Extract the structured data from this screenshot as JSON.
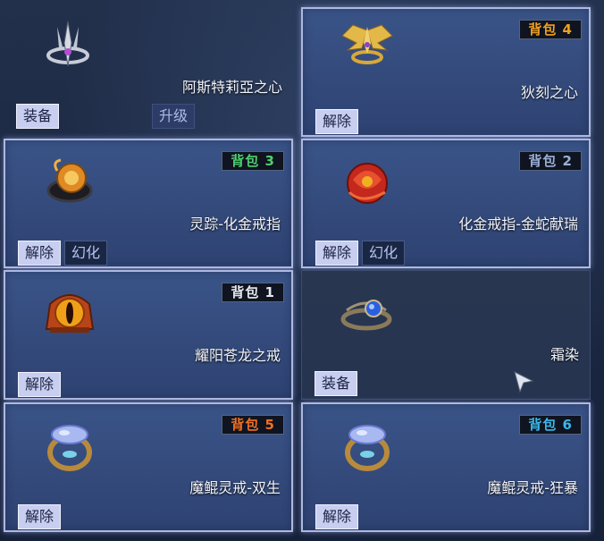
{
  "cards": [
    {
      "name": "阿斯特莉亞之心",
      "primary": "装备",
      "upgrade": "升级",
      "icon": "trident-ring-icon"
    },
    {
      "name": "狄刻之心",
      "badge": "背包 4",
      "badge_color": "#f0a020",
      "primary": "解除",
      "icon": "winged-ring-icon"
    },
    {
      "name": "灵踪-化金戒指",
      "badge": "背包 3",
      "badge_color": "#4fcf6f",
      "primary": "解除",
      "secondary": "幻化",
      "icon": "flame-band-ring-icon"
    },
    {
      "name": "化金戒指-金蛇献瑞",
      "badge": "背包 2",
      "badge_color": "#9ab0d8",
      "primary": "解除",
      "secondary": "幻化",
      "icon": "red-serpent-ring-icon"
    },
    {
      "name": "耀阳苍龙之戒",
      "badge": "背包 1",
      "badge_color": "#e6e8ee",
      "primary": "解除",
      "icon": "dragon-eye-ring-icon"
    },
    {
      "name": "霜染",
      "primary": "装备",
      "icon": "frost-sapphire-ring-icon"
    },
    {
      "name": "魔鲲灵戒-双生",
      "badge": "背包 5",
      "badge_color": "#f07020",
      "primary": "解除",
      "icon": "opal-ring-icon"
    },
    {
      "name": "魔鲲灵戒-狂暴",
      "badge": "背包 6",
      "badge_color": "#3ab8e8",
      "primary": "解除",
      "icon": "opal-ring-icon"
    }
  ]
}
